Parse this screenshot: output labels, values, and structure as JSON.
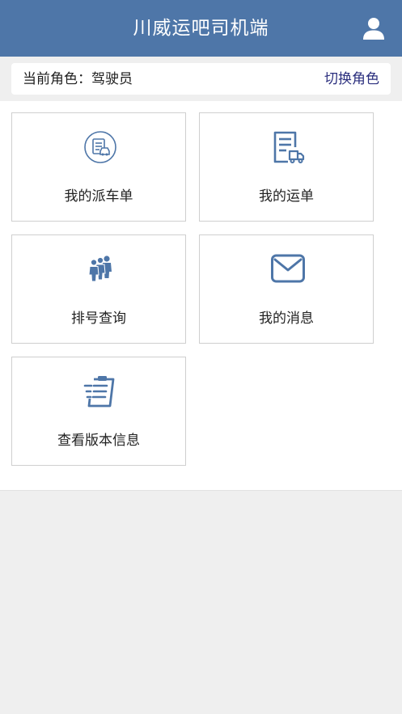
{
  "header": {
    "title": "川威运吧司机端",
    "user_icon": "user-icon"
  },
  "role": {
    "label": "当前角色：驾驶员",
    "switch_label": "切换角色"
  },
  "menu": [
    {
      "label": "我的派车单",
      "icon": "dispatch-order-icon"
    },
    {
      "label": "我的运单",
      "icon": "waybill-icon"
    },
    {
      "label": "排号查询",
      "icon": "queue-people-icon"
    },
    {
      "label": "我的消息",
      "icon": "mail-icon"
    },
    {
      "label": "查看版本信息",
      "icon": "clipboard-list-icon"
    }
  ],
  "colors": {
    "header_bg": "#4e76a8",
    "icon": "#4e76a8",
    "switch_link": "#2b2f7e",
    "page_bg": "#efefef"
  }
}
